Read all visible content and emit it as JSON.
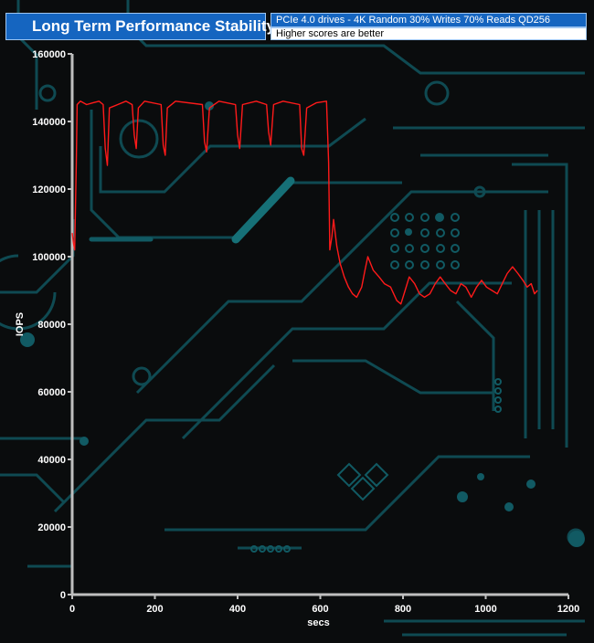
{
  "header": {
    "title": "Long Term Performance Stability",
    "subtitle": "PCIe 4.0 drives - 4K Random 30% Writes 70% Reads QD256",
    "note": "Higher scores are better"
  },
  "colors": {
    "series": "#ff1a1a",
    "axis": "#bfbfbf",
    "text": "#ffffff",
    "header_bg": "#1565c0",
    "circuit": "#0f4a52",
    "circuit_bright": "#1c7f86"
  },
  "chart_data": {
    "type": "line",
    "title": "Long Term Performance Stability",
    "xlabel": "secs",
    "ylabel": "IOPS",
    "xlim": [
      0,
      1200
    ],
    "ylim": [
      0,
      160000
    ],
    "x_ticks": [
      0,
      200,
      400,
      600,
      800,
      1000,
      1200
    ],
    "y_ticks": [
      0,
      20000,
      40000,
      60000,
      80000,
      100000,
      120000,
      140000,
      160000
    ],
    "x_tick_labels": [
      "0",
      "200",
      "400",
      "600",
      "800",
      "1000",
      "1200"
    ],
    "y_tick_labels": [
      "0",
      "20000",
      "40000",
      "60000",
      "80000",
      "100000",
      "120000",
      "140000",
      "160000"
    ],
    "grid": false,
    "series": [
      {
        "values": [
          [
            0,
            107000
          ],
          [
            3,
            104000
          ],
          [
            6,
            102000
          ],
          [
            10,
            128000
          ],
          [
            12,
            145000
          ],
          [
            20,
            146000
          ],
          [
            35,
            145000
          ],
          [
            50,
            145500
          ],
          [
            65,
            146000
          ],
          [
            75,
            145000
          ],
          [
            80,
            132000
          ],
          [
            85,
            127000
          ],
          [
            90,
            144000
          ],
          [
            110,
            145000
          ],
          [
            130,
            146000
          ],
          [
            145,
            145000
          ],
          [
            150,
            136000
          ],
          [
            155,
            132000
          ],
          [
            160,
            144000
          ],
          [
            175,
            146000
          ],
          [
            215,
            145000
          ],
          [
            220,
            133000
          ],
          [
            225,
            130000
          ],
          [
            230,
            144000
          ],
          [
            250,
            146000
          ],
          [
            315,
            145000
          ],
          [
            320,
            134000
          ],
          [
            325,
            131000
          ],
          [
            332,
            144000
          ],
          [
            355,
            146000
          ],
          [
            395,
            145000
          ],
          [
            400,
            136000
          ],
          [
            405,
            132000
          ],
          [
            412,
            145000
          ],
          [
            445,
            146000
          ],
          [
            470,
            145000
          ],
          [
            475,
            137000
          ],
          [
            480,
            133000
          ],
          [
            487,
            145000
          ],
          [
            510,
            146000
          ],
          [
            550,
            145000
          ],
          [
            555,
            132000
          ],
          [
            560,
            130000
          ],
          [
            567,
            144000
          ],
          [
            590,
            145500
          ],
          [
            615,
            146000
          ],
          [
            620,
            128000
          ],
          [
            623,
            102000
          ],
          [
            628,
            106000
          ],
          [
            632,
            111000
          ],
          [
            640,
            103000
          ],
          [
            648,
            98000
          ],
          [
            658,
            94000
          ],
          [
            668,
            91000
          ],
          [
            678,
            89000
          ],
          [
            688,
            88000
          ],
          [
            700,
            91000
          ],
          [
            708,
            96000
          ],
          [
            715,
            100000
          ],
          [
            728,
            96000
          ],
          [
            742,
            94000
          ],
          [
            755,
            92000
          ],
          [
            770,
            91000
          ],
          [
            785,
            87000
          ],
          [
            795,
            86000
          ],
          [
            805,
            90000
          ],
          [
            815,
            94000
          ],
          [
            828,
            92000
          ],
          [
            840,
            89000
          ],
          [
            852,
            88000
          ],
          [
            865,
            89000
          ],
          [
            878,
            92000
          ],
          [
            890,
            94000
          ],
          [
            902,
            92000
          ],
          [
            915,
            90000
          ],
          [
            928,
            89000
          ],
          [
            940,
            92000
          ],
          [
            952,
            91000
          ],
          [
            965,
            88000
          ],
          [
            978,
            91000
          ],
          [
            990,
            93000
          ],
          [
            1002,
            91000
          ],
          [
            1015,
            90000
          ],
          [
            1028,
            89000
          ],
          [
            1040,
            92000
          ],
          [
            1052,
            95000
          ],
          [
            1065,
            97000
          ],
          [
            1078,
            95000
          ],
          [
            1090,
            93000
          ],
          [
            1100,
            91000
          ],
          [
            1110,
            92000
          ],
          [
            1118,
            89000
          ],
          [
            1125,
            90000
          ]
        ]
      }
    ]
  }
}
